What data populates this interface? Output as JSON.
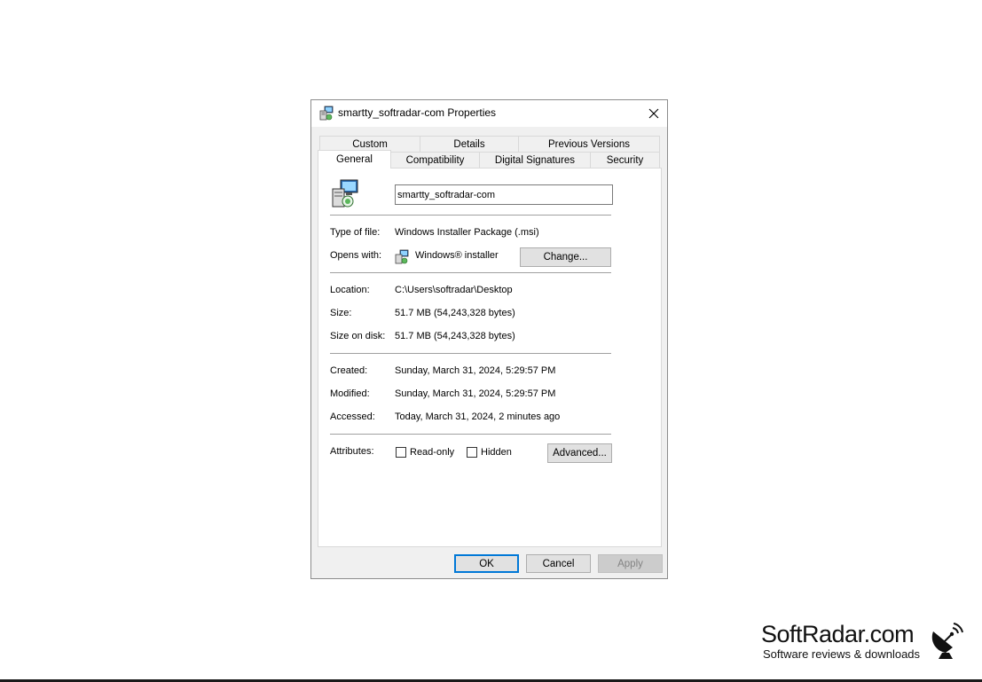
{
  "dialog": {
    "title": "smartty_softradar-com Properties",
    "tabs_row1": [
      "Custom",
      "Details",
      "Previous Versions"
    ],
    "tabs_row2": [
      "General",
      "Compatibility",
      "Digital Signatures",
      "Security"
    ],
    "active_tab": "General",
    "file_name": "smartty_softradar-com",
    "fields": {
      "type_label": "Type of file:",
      "type_value": "Windows Installer Package (.msi)",
      "opens_label": "Opens with:",
      "opens_value": "Windows® installer",
      "change_button": "Change...",
      "location_label": "Location:",
      "location_value": "C:\\Users\\softradar\\Desktop",
      "size_label": "Size:",
      "size_value": "51.7 MB (54,243,328 bytes)",
      "size_on_disk_label": "Size on disk:",
      "size_on_disk_value": "51.7 MB (54,243,328 bytes)",
      "created_label": "Created:",
      "created_value": "Sunday, March 31, 2024, 5:29:57 PM",
      "modified_label": "Modified:",
      "modified_value": "Sunday, March 31, 2024, 5:29:57 PM",
      "accessed_label": "Accessed:",
      "accessed_value": "Today, March 31, 2024, 2 minutes ago",
      "attributes_label": "Attributes:",
      "readonly_label": "Read-only",
      "hidden_label": "Hidden",
      "advanced_button": "Advanced..."
    },
    "buttons": {
      "ok": "OK",
      "cancel": "Cancel",
      "apply": "Apply"
    }
  },
  "watermark": {
    "title": "SoftRadar.com",
    "subtitle": "Software reviews & downloads"
  },
  "icons": {
    "title_icon": "msi-installer-icon",
    "close_icon": "close-icon",
    "file_icon": "msi-package-icon",
    "opens_icon": "windows-installer-icon",
    "logo_icon": "satellite-dish-icon"
  }
}
